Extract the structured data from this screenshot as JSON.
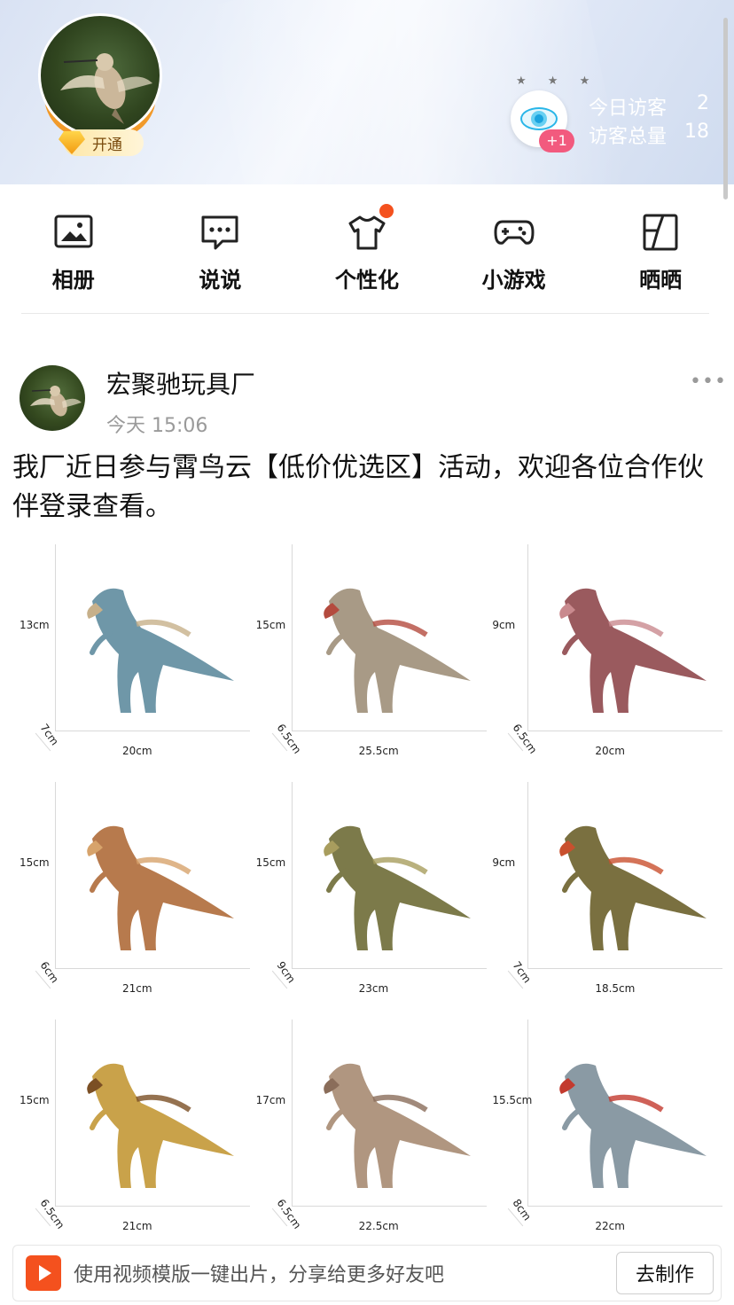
{
  "header": {
    "vip_label": "开通",
    "visitor_badge": "+1",
    "today_visitors_label": "今日访客",
    "today_visitors_value": "2",
    "total_visitors_label": "访客总量",
    "total_visitors_value": "18"
  },
  "nav": {
    "items": [
      {
        "label": "相册",
        "icon": "photo-album-icon"
      },
      {
        "label": "说说",
        "icon": "message-bubble-icon"
      },
      {
        "label": "个性化",
        "icon": "tshirt-icon"
      },
      {
        "label": "小游戏",
        "icon": "gamepad-icon"
      },
      {
        "label": "晒晒",
        "icon": "share-frame-icon"
      }
    ]
  },
  "post": {
    "author": "宏聚驰玩具厂",
    "time": "今天 15:06",
    "text": "我厂近日参与霄鸟云【低价优选区】活动，欢迎各位合作伙伴登录查看。",
    "products": [
      {
        "height": "13cm",
        "width": "20cm",
        "depth": "7cm",
        "body": "#6f97a8",
        "accent": "#c7b08a"
      },
      {
        "height": "15cm",
        "width": "25.5cm",
        "depth": "6.5cm",
        "body": "#a89a86",
        "accent": "#b44b3e"
      },
      {
        "height": "9cm",
        "width": "20cm",
        "depth": "6.5cm",
        "body": "#9a5a5e",
        "accent": "#c98a8e"
      },
      {
        "height": "15cm",
        "width": "21cm",
        "depth": "6cm",
        "body": "#b77a4d",
        "accent": "#d7a36b"
      },
      {
        "height": "15cm",
        "width": "23cm",
        "depth": "9cm",
        "body": "#7c7a4a",
        "accent": "#a89d5e"
      },
      {
        "height": "9cm",
        "width": "18.5cm",
        "depth": "7cm",
        "body": "#7a7040",
        "accent": "#c9502e"
      },
      {
        "height": "15cm",
        "width": "21cm",
        "depth": "6.5cm",
        "body": "#c9a24a",
        "accent": "#7b4f24"
      },
      {
        "height": "17cm",
        "width": "22.5cm",
        "depth": "6.5cm",
        "body": "#b09680",
        "accent": "#8a6d5a"
      },
      {
        "height": "15.5cm",
        "width": "22cm",
        "depth": "8cm",
        "body": "#8a9aa4",
        "accent": "#c33a2e"
      }
    ]
  },
  "bottom_bar": {
    "text": "使用视频模版一键出片，分享给更多好友吧",
    "button": "去制作"
  }
}
